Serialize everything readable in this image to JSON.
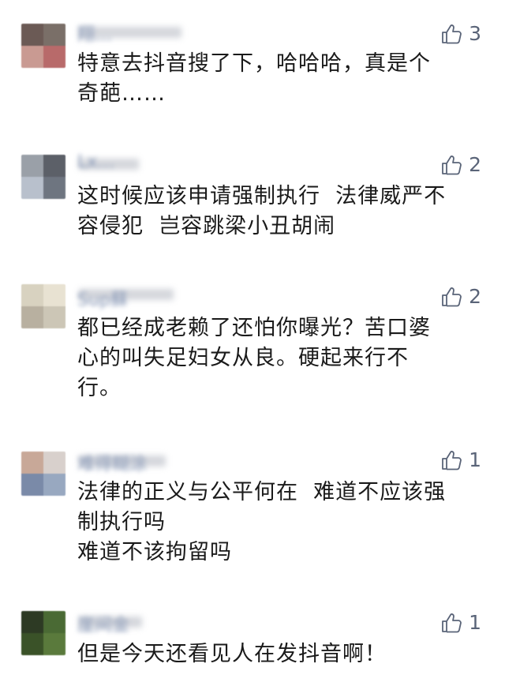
{
  "comments": [
    {
      "name": "翔…",
      "likes": "3",
      "lines": [
        "特意去抖音搜了下，哈哈哈，真是个",
        "奇葩……"
      ],
      "avatar_colors": [
        "#6b5a55",
        "#7a6f68",
        "#c99a92",
        "#b86a6a"
      ]
    },
    {
      "name": "Lx…",
      "likes": "2",
      "lines": [
        "这时候应该申请强制执行  法律威严不",
        "容侵犯  岂容跳梁小丑胡闹"
      ],
      "avatar_colors": [
        "#9aa0a8",
        "#5c6068",
        "#b8c0cc",
        "#6e7580"
      ]
    },
    {
      "name": "Sup蘇",
      "likes": "2",
      "lines": [
        "都已经成老赖了还怕你曝光？苦口婆",
        "心的叫失足妇女从良。硬起来行不",
        "行。"
      ],
      "avatar_colors": [
        "#d8d2c0",
        "#e8e2d2",
        "#b8b0a0",
        "#ccc6b6"
      ]
    },
    {
      "name": "难得糊涂",
      "likes": "1",
      "lines": [
        "法律的正义与公平何在  难道不应该强",
        "制执行吗",
        "难道不该拘留吗"
      ],
      "avatar_colors": [
        "#c8a898",
        "#d8d0cc",
        "#7a8aa8",
        "#98a8c0"
      ]
    },
    {
      "name": "崖间金",
      "likes": "1",
      "lines": [
        "但是今天还看见人在发抖音啊！"
      ],
      "avatar_colors": [
        "#2d3a24",
        "#4a6a34",
        "#3a5228",
        "#5a7a3c"
      ]
    }
  ],
  "colors": {
    "text": "#1a1a1a",
    "like_text": "#5a6478",
    "name_text": "#8a9ab8",
    "background": "#ffffff"
  },
  "icons": {
    "like": "thumbs-up-icon"
  }
}
